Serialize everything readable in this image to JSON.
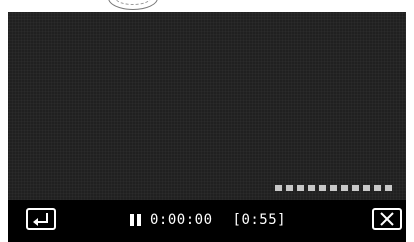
{
  "player": {
    "elapsed_time": "0:00:00",
    "remaining_time": "[0:55]",
    "state": "paused",
    "progress_markers": 11
  },
  "icons": {
    "back": "back-arrow-icon",
    "pause": "pause-icon",
    "close": "close-icon"
  },
  "colors": {
    "screen_bg": "#202020",
    "control_bar_bg": "#000000",
    "text": "#ffffff",
    "progress_marker": "#c8c8c8"
  }
}
